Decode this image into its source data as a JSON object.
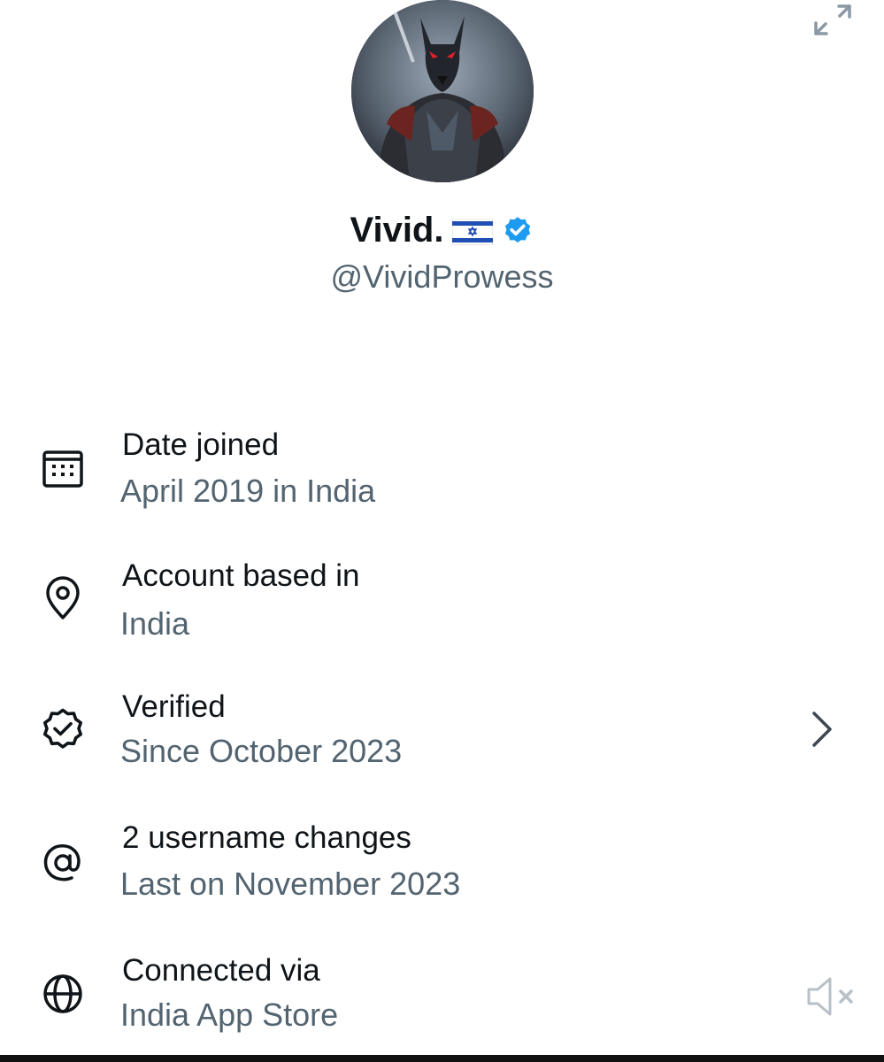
{
  "profile": {
    "display_name": "Vivid.",
    "handle": "@VividProwess",
    "flag": "israel-flag",
    "verified_badge_color": "#1d9bf0"
  },
  "rows": [
    {
      "icon": "calendar-icon",
      "title": "Date joined",
      "subtitle": "April 2019 in India"
    },
    {
      "icon": "location-pin-icon",
      "title": "Account based in",
      "subtitle": "India"
    },
    {
      "icon": "verified-badge-outline-icon",
      "title": "Verified",
      "subtitle": "Since October 2023"
    },
    {
      "icon": "at-sign-icon",
      "title": "2 username changes",
      "subtitle": "Last on November 2023"
    },
    {
      "icon": "globe-icon",
      "title": "Connected via",
      "subtitle": "India App Store"
    }
  ],
  "overlay": {
    "expand": "expand-icon",
    "mute": "speaker-muted-icon"
  },
  "colors": {
    "primary_text": "#0f1419",
    "secondary_text": "#536471",
    "accent": "#1d9bf0"
  }
}
